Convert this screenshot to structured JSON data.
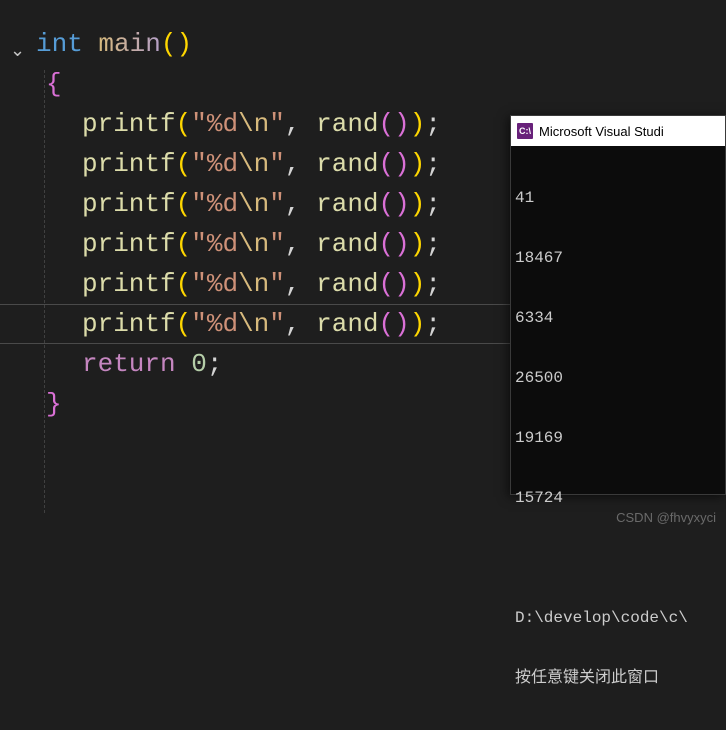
{
  "code": {
    "type_kw": "int",
    "main_fn": "main",
    "open_brace": "{",
    "close_brace": "}",
    "printf_fn": "printf",
    "rand_fn": "rand",
    "fmt_open": "\"",
    "fmt_pct": "%d",
    "fmt_esc": "\\n",
    "fmt_close": "\"",
    "comma_sp": ", ",
    "semicolon": ";",
    "return_kw": "return",
    "zero": "0"
  },
  "console": {
    "title": "Microsoft Visual Studi",
    "icon_text": "C:\\",
    "outputs": [
      "41",
      "18467",
      "6334",
      "26500",
      "19169",
      "15724"
    ],
    "path_line": "D:\\develop\\code\\c\\",
    "prompt_line": "按任意键关闭此窗口"
  },
  "watermark": "CSDN @fhvyxyci"
}
